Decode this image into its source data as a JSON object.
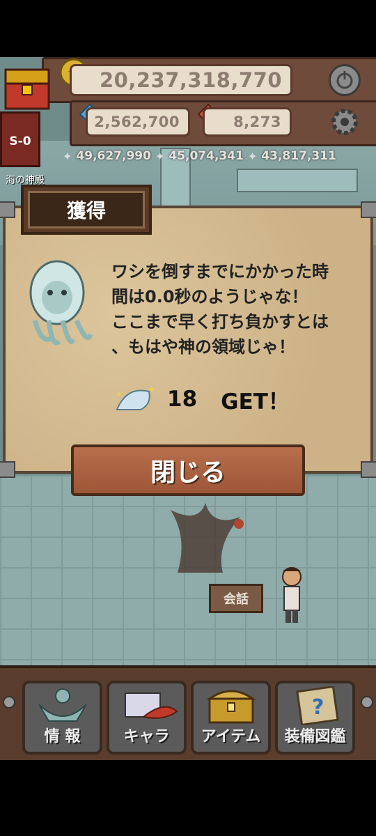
{
  "hud": {
    "gold": "20,237,318,770",
    "gems": "2,562,700",
    "crystals": "8,273",
    "stage": "S-0",
    "location": "海の神殿",
    "stats": [
      "49,627,990",
      "45,074,341",
      "43,817,311"
    ]
  },
  "dialog": {
    "title": "獲得",
    "message_lines": [
      "ワシを倒すまでにかかった時",
      "間は0.0秒のようじゃな！",
      "ここまで早く打ち負かすとは",
      "、もはや神の領域じゃ！"
    ],
    "reward_count": "18",
    "reward_text": "GET！",
    "close_label": "閉じる"
  },
  "scene": {
    "talk_label": "会話"
  },
  "nav": {
    "items": [
      {
        "label": "情 報",
        "icon": "info-icon"
      },
      {
        "label": "キャラ",
        "icon": "character-icon"
      },
      {
        "label": "アイテム",
        "icon": "treasure-chest-icon"
      },
      {
        "label": "装備図鑑",
        "icon": "book-icon"
      }
    ]
  },
  "colors": {
    "wood": "#6e4b3b",
    "button": "#a65d3b",
    "parchment": "#d2b98e"
  }
}
